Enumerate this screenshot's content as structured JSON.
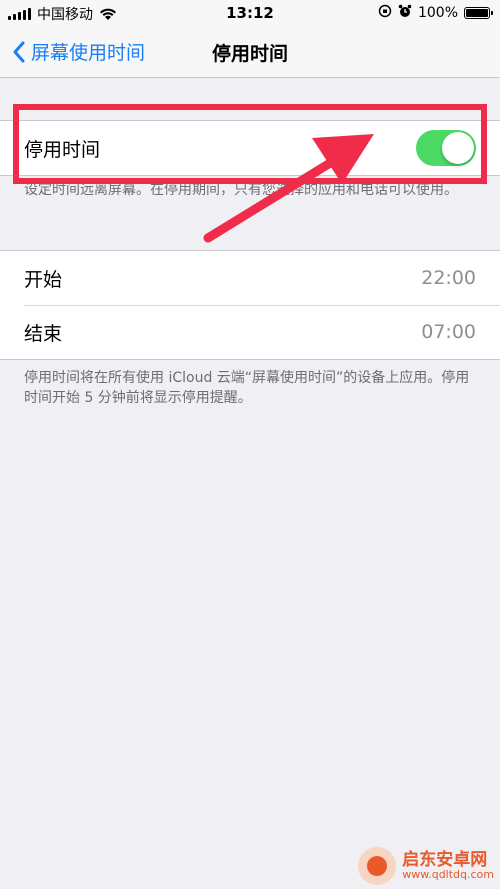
{
  "status_bar": {
    "carrier": "中国移动",
    "time": "13:12",
    "battery_text": "100%",
    "battery_level": 1.0,
    "icons": [
      "signal-icon",
      "wifi-icon",
      "rotation-lock-icon",
      "alarm-icon",
      "battery-icon"
    ]
  },
  "nav": {
    "back_label": "屏幕使用时间",
    "title": "停用时间"
  },
  "toggle_section": {
    "label": "停用时间",
    "enabled": true,
    "description": "设定时间远离屏幕。在停用期间，只有您选择的应用和电话可以使用。"
  },
  "schedule": [
    {
      "label": "开始",
      "value": "22:00"
    },
    {
      "label": "结束",
      "value": "07:00"
    }
  ],
  "footer": "停用时间将在所有使用 iCloud 云端“屏幕使用时间”的设备上应用。停用时间开始 5 分钟前将显示停用提醒。",
  "watermark": {
    "name": "启东安卓网",
    "url": "www.qdltdq.com"
  },
  "colors": {
    "accent": "#1a7ef5",
    "toggle_on": "#4cd964",
    "annotation": "#ef2d4b",
    "background": "#efeff4"
  }
}
